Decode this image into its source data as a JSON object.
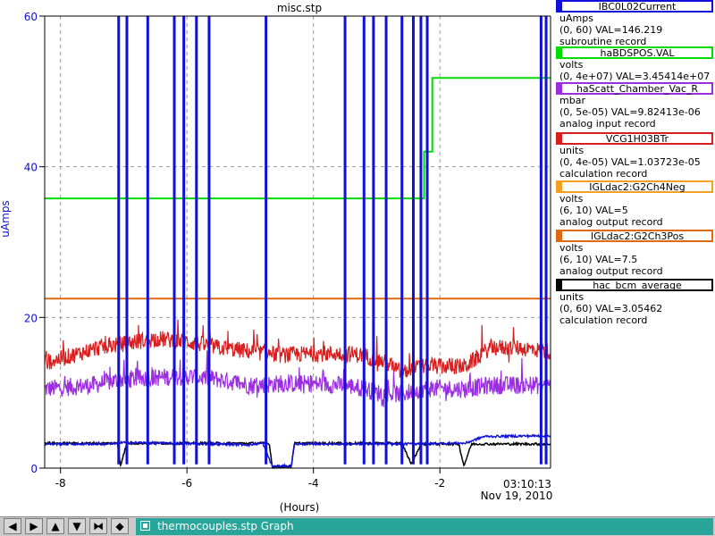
{
  "chart_data": {
    "type": "line",
    "title": "misc.stp",
    "xlabel": "(Hours)",
    "ylabel": "uAmps",
    "xlim": [
      -8.25,
      -0.25
    ],
    "ylim": [
      0,
      60
    ],
    "x_ticks": [
      -8,
      -6,
      -4,
      -2
    ],
    "x_tick_labels": [
      "-8",
      "-6",
      "-4",
      "-2"
    ],
    "y_ticks": [
      0,
      20,
      40,
      60
    ],
    "y_tick_labels": [
      "0",
      "20",
      "40",
      "60"
    ],
    "end_time_label": "03:10:13",
    "end_date_label": "Nov 19, 2010",
    "grid": true,
    "series": [
      {
        "name": "IBC0L02Current",
        "color": "#1010d8",
        "baseline": [
          [
            -8.25,
            3.2
          ],
          [
            -7.2,
            3.2
          ],
          [
            -7.0,
            3.4
          ],
          [
            -5.0,
            3.1
          ],
          [
            -4.8,
            3.3
          ],
          [
            -4.65,
            0.2
          ],
          [
            -4.35,
            0.3
          ],
          [
            -4.3,
            3.2
          ],
          [
            -2.6,
            3.2
          ],
          [
            -1.95,
            3.3
          ],
          [
            -1.6,
            3.3
          ],
          [
            -1.3,
            4.2
          ],
          [
            -0.25,
            4.3
          ]
        ],
        "spikes": [
          -7.08,
          -6.95,
          -6.62,
          -6.2,
          -6.05,
          -5.85,
          -5.65,
          -4.75,
          -3.5,
          -3.2,
          -3.05,
          -2.85,
          -2.6,
          -2.42,
          -2.3,
          -2.2,
          -0.4,
          -0.32
        ]
      },
      {
        "name": "haBDSPOS.VAL",
        "color": "#00dd00",
        "points": [
          [
            -8.25,
            35.8
          ],
          [
            -2.25,
            35.8
          ],
          [
            -2.25,
            42.0
          ],
          [
            -2.12,
            42.0
          ],
          [
            -2.12,
            51.8
          ],
          [
            -0.25,
            51.8
          ]
        ]
      },
      {
        "name": "haScatt_Chamber_Vac_R",
        "color": "#9a2ee0",
        "points": [
          [
            -8.25,
            10.5
          ],
          [
            -7.5,
            11.0
          ],
          [
            -7.0,
            11.8
          ],
          [
            -6.5,
            12.0
          ],
          [
            -6.0,
            12.2
          ],
          [
            -5.5,
            11.8
          ],
          [
            -5.0,
            11.0
          ],
          [
            -4.5,
            11.2
          ],
          [
            -4.0,
            11.2
          ],
          [
            -3.5,
            11.0
          ],
          [
            -3.2,
            10.6
          ],
          [
            -3.0,
            10.0
          ],
          [
            -2.6,
            9.8
          ],
          [
            -2.3,
            10.5
          ],
          [
            -2.0,
            10.6
          ],
          [
            -1.6,
            10.5
          ],
          [
            -1.2,
            11.0
          ],
          [
            -0.8,
            11.0
          ],
          [
            -0.25,
            11.0
          ]
        ]
      },
      {
        "name": "VCG1H03BTr",
        "color": "#d81e1e",
        "points": [
          [
            -8.25,
            14.0
          ],
          [
            -7.8,
            15.0
          ],
          [
            -7.4,
            16.0
          ],
          [
            -7.0,
            16.5
          ],
          [
            -6.5,
            17.2
          ],
          [
            -6.0,
            16.8
          ],
          [
            -5.5,
            16.0
          ],
          [
            -5.0,
            15.5
          ],
          [
            -4.5,
            15.0
          ],
          [
            -4.0,
            15.2
          ],
          [
            -3.5,
            15.2
          ],
          [
            -3.2,
            15.0
          ],
          [
            -2.8,
            13.8
          ],
          [
            -2.6,
            12.6
          ],
          [
            -2.3,
            13.5
          ],
          [
            -2.0,
            13.5
          ],
          [
            -1.6,
            13.5
          ],
          [
            -1.2,
            16.0
          ],
          [
            -0.8,
            16.0
          ],
          [
            -0.25,
            15.5
          ]
        ]
      },
      {
        "name": "IGLdac2:G2Ch4Neg",
        "color": "#f4a020",
        "points": []
      },
      {
        "name": "IGLdac2:G2Ch3Pos",
        "color": "#e06a10",
        "points": [
          [
            -8.25,
            22.5
          ],
          [
            -0.25,
            22.5
          ]
        ]
      },
      {
        "name": "hac_bcm_average",
        "color": "#000000",
        "baseline": [
          [
            -8.25,
            3.3
          ],
          [
            -7.1,
            3.3
          ],
          [
            -7.05,
            0.4
          ],
          [
            -6.95,
            3.3
          ],
          [
            -4.7,
            3.3
          ],
          [
            -4.65,
            0.2
          ],
          [
            -4.35,
            0.2
          ],
          [
            -4.3,
            3.3
          ],
          [
            -2.6,
            3.3
          ],
          [
            -2.45,
            0.5
          ],
          [
            -2.3,
            3.2
          ],
          [
            -1.7,
            3.2
          ],
          [
            -1.62,
            0.3
          ],
          [
            -1.5,
            3.2
          ],
          [
            -0.25,
            3.2
          ]
        ]
      }
    ]
  },
  "legend": [
    {
      "name": "IBC0L02Current",
      "color": "#1010d8",
      "unit": "uAmps",
      "range": "(0, 60) VAL=146.219",
      "record": "subroutine record"
    },
    {
      "name": "haBDSPOS.VAL",
      "color": "#00dd00",
      "unit": "volts",
      "range": "(0, 4e+07) VAL=3.45414e+07",
      "record": ""
    },
    {
      "name": "haScatt_Chamber_Vac_R",
      "color": "#9a2ee0",
      "unit": "mbar",
      "range": "(0, 5e-05) VAL=9.82413e-06",
      "record": "analog input record"
    },
    {
      "name": "VCG1H03BTr",
      "color": "#d81e1e",
      "unit": "units",
      "range": "(0, 4e-05) VAL=1.03723e-05",
      "record": "calculation record"
    },
    {
      "name": "IGLdac2:G2Ch4Neg",
      "color": "#f4a020",
      "unit": "volts",
      "range": "(6, 10) VAL=5",
      "record": "analog output record"
    },
    {
      "name": "IGLdac2:G2Ch3Pos",
      "color": "#e06a10",
      "unit": "volts",
      "range": "(6, 10) VAL=7.5",
      "record": "analog output record"
    },
    {
      "name": "hac_bcm_average",
      "color": "#000000",
      "unit": "units",
      "range": "(0, 60) VAL=3.05462",
      "record": "calculation record"
    }
  ],
  "toolbar": {
    "buttons": [
      {
        "name": "scroll-left-button",
        "glyph": "◀"
      },
      {
        "name": "scroll-right-button",
        "glyph": "▶"
      },
      {
        "name": "scroll-up-button",
        "glyph": "▲"
      },
      {
        "name": "scroll-down-button",
        "glyph": "▼"
      },
      {
        "name": "zoom-in-button",
        "glyph": "⧓"
      },
      {
        "name": "zoom-out-button",
        "glyph": "◆"
      }
    ],
    "tab_label": "thermocouples.stp Graph"
  }
}
